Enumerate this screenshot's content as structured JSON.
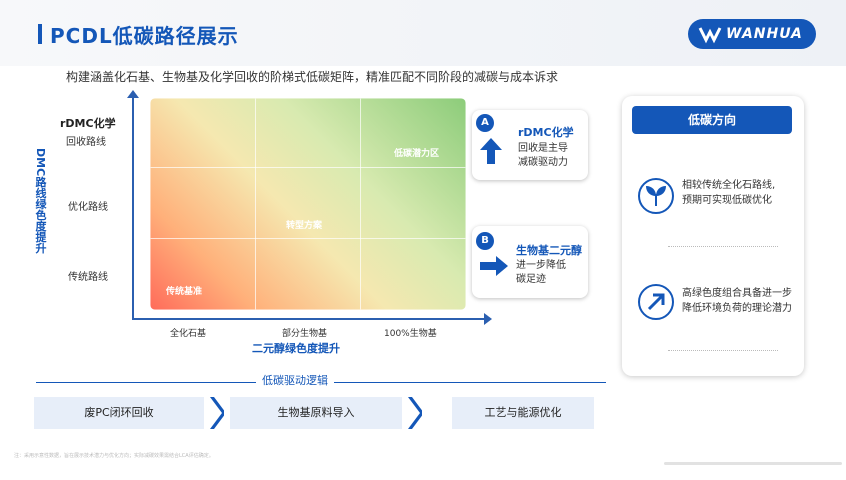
{
  "header": {
    "title": "PCDL低碳路径展示",
    "logo_text": "WANHUA",
    "subtitle": "构建涵盖化石基、生物基及化学回收的阶梯式低碳矩阵，精准匹配不同阶段的减碳与成本诉求"
  },
  "matrix": {
    "y_axis_title": "DMC路线绿色度提升",
    "y_top_label": "rDMC化学",
    "y_ticks": [
      "回收路线",
      "优化路线",
      "传统路线"
    ],
    "x_ticks": [
      "全化石基",
      "部分生物基",
      "100%生物基"
    ],
    "x_axis_title": "二元醇绿色度提升",
    "zones": {
      "low": "传统基准",
      "mid": "转型方案",
      "high": "低碳潜力区"
    }
  },
  "cards": [
    {
      "badge": "A",
      "title": "rDMC化学",
      "lines": [
        "回收是主导",
        "减碳驱动力"
      ]
    },
    {
      "badge": "B",
      "title": "生物基二元醇",
      "lines": [
        "进一步降低",
        "碳足迹"
      ]
    }
  ],
  "side_panel": {
    "heading": "低碳方向",
    "items": [
      {
        "text_1": "相较传统全化石路线,",
        "text_2": "预期可实现低碳优化"
      },
      {
        "text_1": "高绿色度组合具备进一步",
        "text_2": "降低环境负荷的理论潜力"
      }
    ]
  },
  "drivers": {
    "title": "低碳驱动逻辑",
    "steps": [
      "废PC闭环回收",
      "生物基原料导入",
      "工艺与能源优化"
    ]
  },
  "footnote": "注：采用示意性数据，旨在展示技术潜力与优化方向；实际减碳效果需结合LCA评估确定。",
  "colors": {
    "brand": "#1457b8",
    "low": "#ff6b5a",
    "high": "#8ccc7a"
  }
}
